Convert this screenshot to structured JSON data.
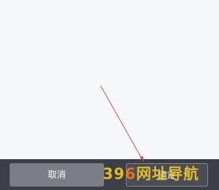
{
  "dialog": {
    "cancel_label": "取消",
    "confirm_label": "确定"
  },
  "watermark": {
    "part_a": "3",
    "part_b": "9",
    "part_c": "6",
    "part_d": "网址导航"
  },
  "colors": {
    "background": "#f6f7f9",
    "bar": "#3c3f45",
    "cancel_button": "#7b7e86",
    "confirm_button": "#4a4d54",
    "arrow": "#d9453c"
  }
}
